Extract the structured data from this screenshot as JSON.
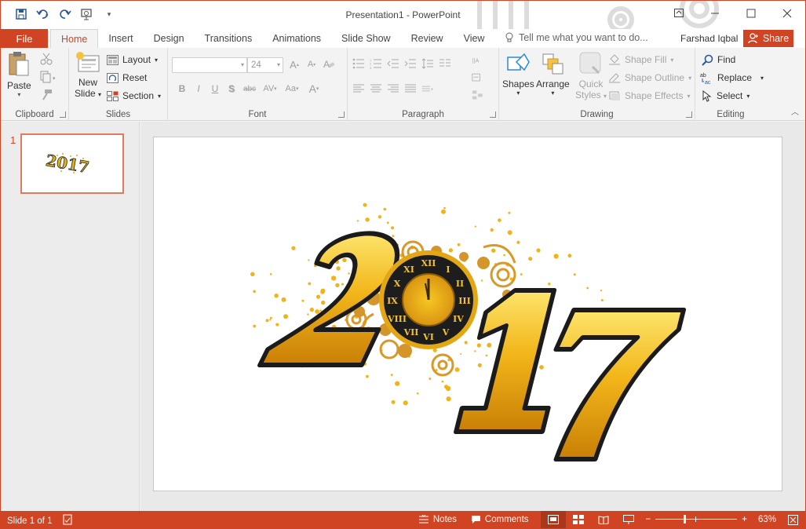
{
  "window": {
    "title": "Presentation1 - PowerPoint",
    "user": "Farshad Iqbal",
    "share_label": "Share",
    "accent": "#d04423"
  },
  "qat": {
    "icons": [
      "save-icon",
      "undo-icon",
      "redo-icon",
      "present-icon",
      "customize-icon"
    ]
  },
  "tabs": {
    "file": "File",
    "items": [
      "Home",
      "Insert",
      "Design",
      "Transitions",
      "Animations",
      "Slide Show",
      "Review",
      "View"
    ],
    "active": "Home",
    "tellme_placeholder": "Tell me what you want to do..."
  },
  "ribbon": {
    "clipboard": {
      "label": "Clipboard",
      "paste": "Paste"
    },
    "slides": {
      "label": "Slides",
      "new_slide_1": "New",
      "new_slide_2": "Slide",
      "layout": "Layout",
      "reset": "Reset",
      "section": "Section"
    },
    "font": {
      "label": "Font",
      "font_name": "",
      "font_size": "24",
      "bold": "B",
      "italic": "I",
      "underline": "U",
      "shadow": "S",
      "strike": "abc",
      "spacing": "AV",
      "case": "Aa",
      "color": "A"
    },
    "paragraph": {
      "label": "Paragraph"
    },
    "drawing": {
      "label": "Drawing",
      "shapes": "Shapes",
      "arrange": "Arrange",
      "quick_styles_1": "Quick",
      "quick_styles_2": "Styles",
      "shape_fill": "Shape Fill",
      "shape_outline": "Shape Outline",
      "shape_effects": "Shape Effects"
    },
    "editing": {
      "label": "Editing",
      "find": "Find",
      "replace": "Replace",
      "select": "Select"
    }
  },
  "thumbnails": [
    {
      "number": "1"
    }
  ],
  "slide": {
    "art_text": "2017"
  },
  "status": {
    "slide_info": "Slide 1 of 1",
    "notes": "Notes",
    "comments": "Comments",
    "zoom": "63%"
  }
}
